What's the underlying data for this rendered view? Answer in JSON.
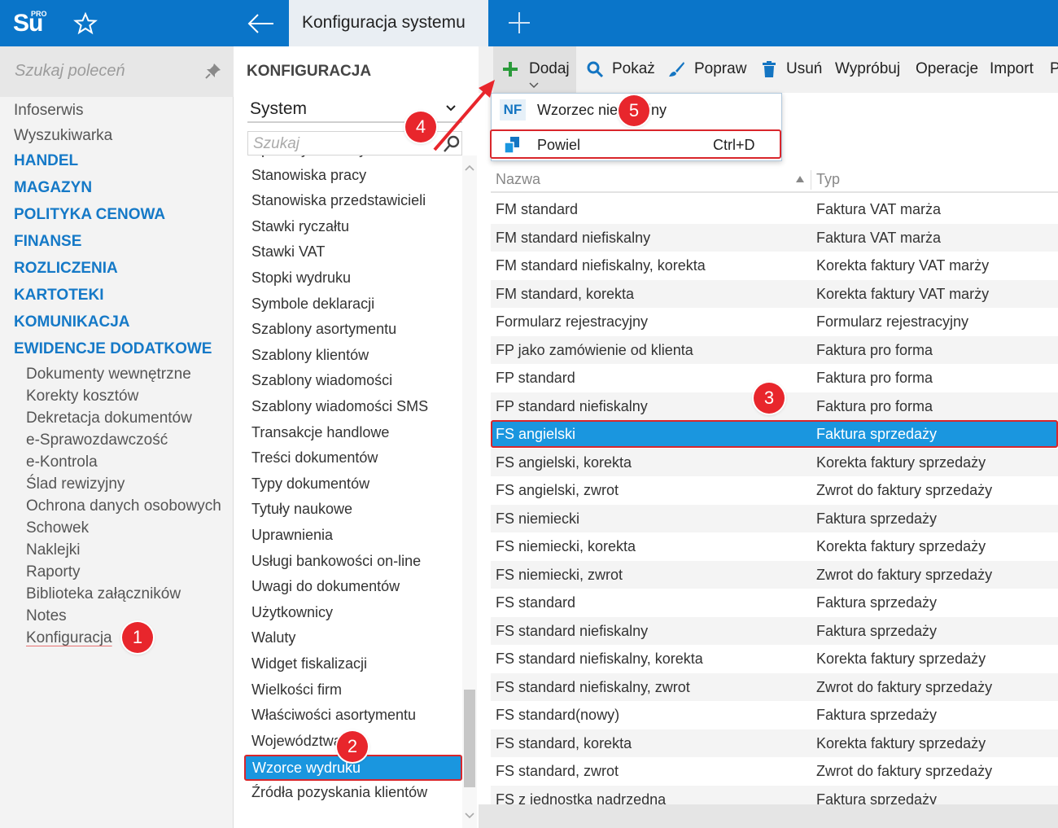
{
  "topbar": {
    "logo_text": "Su",
    "logo_badge": "PRO",
    "active_tab": "Konfiguracja systemu"
  },
  "sidebar": {
    "search_placeholder": "Szukaj poleceń",
    "items": [
      {
        "label": "Infoserwis",
        "kind": "plain"
      },
      {
        "label": "Wyszukiwarka",
        "kind": "plain"
      },
      {
        "label": "HANDEL",
        "kind": "section"
      },
      {
        "label": "MAGAZYN",
        "kind": "section"
      },
      {
        "label": "POLITYKA CENOWA",
        "kind": "section"
      },
      {
        "label": "FINANSE",
        "kind": "section"
      },
      {
        "label": "ROZLICZENIA",
        "kind": "section"
      },
      {
        "label": "KARTOTEKI",
        "kind": "section"
      },
      {
        "label": "KOMUNIKACJA",
        "kind": "section"
      },
      {
        "label": "EWIDENCJE DODATKOWE",
        "kind": "section"
      }
    ],
    "subitems": [
      "Dokumenty wewnętrzne",
      "Korekty kosztów",
      "Dekretacja dokumentów",
      "e-Sprawozdawczość",
      "e-Kontrola",
      "Ślad rewizyjny",
      "Ochrona danych osobowych",
      "Schowek",
      "Naklejki",
      "Raporty",
      "Biblioteka załączników",
      "Notes",
      "Konfiguracja"
    ]
  },
  "middle": {
    "header": "KONFIGURACJA",
    "select_value": "System",
    "search_placeholder": "Szukaj",
    "items": [
      "Sposoby dostawy",
      "Stanowiska pracy",
      "Stanowiska przedstawicieli",
      "Stawki ryczałtu",
      "Stawki VAT",
      "Stopki wydruku",
      "Symbole deklaracji",
      "Szablony asortymentu",
      "Szablony klientów",
      "Szablony wiadomości",
      "Szablony wiadomości SMS",
      "Transakcje handlowe",
      "Treści dokumentów",
      "Typy dokumentów",
      "Tytuły naukowe",
      "Uprawnienia",
      "Usługi bankowości on-line",
      "Uwagi do dokumentów",
      "Użytkownicy",
      "Waluty",
      "Widget fiskalizacji",
      "Wielkości firm",
      "Właściwości asortymentu",
      "Województwa",
      "Wzorce wydruku",
      "Źródła pozyskania klientów"
    ],
    "selected_index": 24
  },
  "toolbar": {
    "dodaj": "Dodaj",
    "pokaz": "Pokaż",
    "popraw": "Popraw",
    "usun": "Usuń",
    "wyprobuj": "Wypróbuj",
    "operacje": "Operacje",
    "import": "Import",
    "more": "P"
  },
  "dropdown": {
    "item1_badge": "NF",
    "item1_label": "Wzorzec niefiskalny",
    "item2_label": "Powiel",
    "item2_shortcut": "Ctrl+D"
  },
  "grid": {
    "col_name": "Nazwa",
    "col_type": "Typ",
    "rows": [
      [
        "FM standard",
        "Faktura VAT marża"
      ],
      [
        "FM standard niefiskalny",
        "Faktura VAT marża"
      ],
      [
        "FM standard niefiskalny, korekta",
        "Korekta faktury VAT marży"
      ],
      [
        "FM standard, korekta",
        "Korekta faktury VAT marży"
      ],
      [
        "Formularz rejestracyjny",
        "Formularz rejestracyjny"
      ],
      [
        "FP jako zamówienie od klienta",
        "Faktura pro forma"
      ],
      [
        "FP standard",
        "Faktura pro forma"
      ],
      [
        "FP standard niefiskalny",
        "Faktura pro forma"
      ],
      [
        "FS angielski",
        "Faktura sprzedaży"
      ],
      [
        "FS angielski, korekta",
        "Korekta faktury sprzedaży"
      ],
      [
        "FS angielski, zwrot",
        "Zwrot do faktury sprzedaży"
      ],
      [
        "FS niemiecki",
        "Faktura sprzedaży"
      ],
      [
        "FS niemiecki, korekta",
        "Korekta faktury sprzedaży"
      ],
      [
        "FS niemiecki, zwrot",
        "Zwrot do faktury sprzedaży"
      ],
      [
        "FS standard",
        "Faktura sprzedaży"
      ],
      [
        "FS standard niefiskalny",
        "Faktura sprzedaży"
      ],
      [
        "FS standard niefiskalny, korekta",
        "Korekta faktury sprzedaży"
      ],
      [
        "FS standard niefiskalny, zwrot",
        "Zwrot do faktury sprzedaży"
      ],
      [
        "FS standard(nowy)",
        "Faktura sprzedaży"
      ],
      [
        "FS standard, korekta",
        "Korekta faktury sprzedaży"
      ],
      [
        "FS standard, zwrot",
        "Zwrot do faktury sprzedaży"
      ],
      [
        "FS z jednostką nadrzędną",
        "Faktura sprzedaży"
      ]
    ],
    "selected_index": 8
  },
  "badges": [
    "1",
    "2",
    "3",
    "4",
    "5"
  ],
  "colors": {
    "brand_blue": "#0a75c9",
    "selection_blue": "#1a96df",
    "highlight_red": "#d9262b",
    "section_blue": "#1579c7"
  }
}
